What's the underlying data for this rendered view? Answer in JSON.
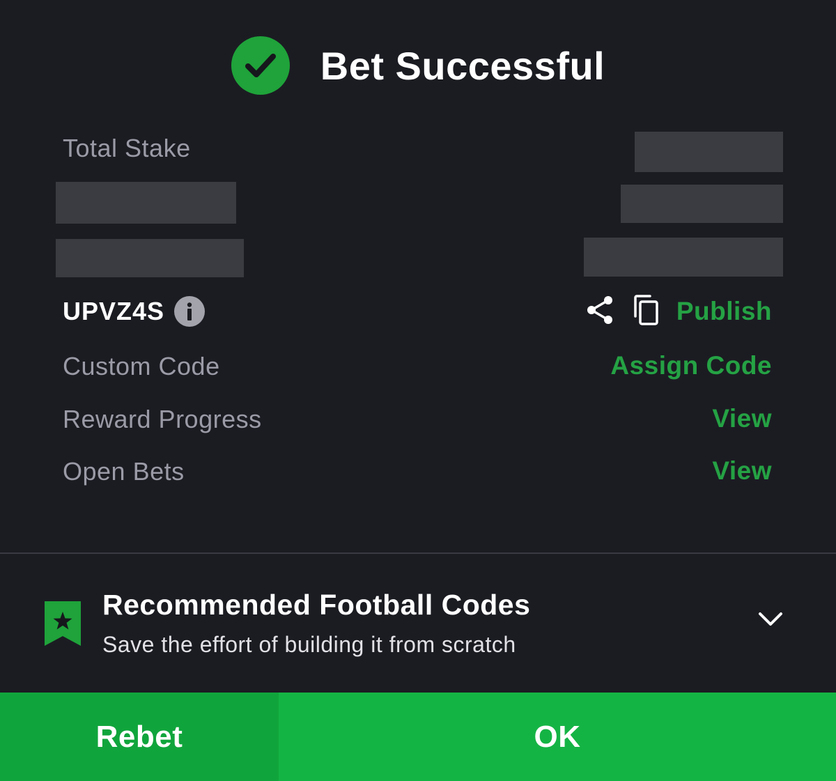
{
  "header": {
    "title": "Bet Successful"
  },
  "details": {
    "total_stake_label": "Total Stake",
    "booking_code": "UPVZ4S",
    "publish_label": "Publish",
    "custom_code_label": "Custom Code",
    "assign_code_label": "Assign Code",
    "reward_progress_label": "Reward Progress",
    "reward_view_label": "View",
    "open_bets_label": "Open Bets",
    "open_bets_view_label": "View"
  },
  "icons": {
    "check": "check-circle-icon",
    "info": "info-icon",
    "share": "share-icon",
    "copy": "copy-icon",
    "bookmark": "bookmark-star-icon",
    "chevron": "chevron-down-icon"
  },
  "recommended": {
    "title": "Recommended Football Codes",
    "subtitle": "Save the effort of building it from scratch"
  },
  "footer": {
    "rebet_label": "Rebet",
    "ok_label": "OK"
  },
  "colors": {
    "background": "#1b1c22",
    "accent_green": "#1fa33a",
    "link_green": "#25a244",
    "rebet_bg": "#10a53c",
    "ok_bg": "#14b444",
    "muted_text": "#9a9ba6",
    "redaction": "#3b3c42"
  }
}
